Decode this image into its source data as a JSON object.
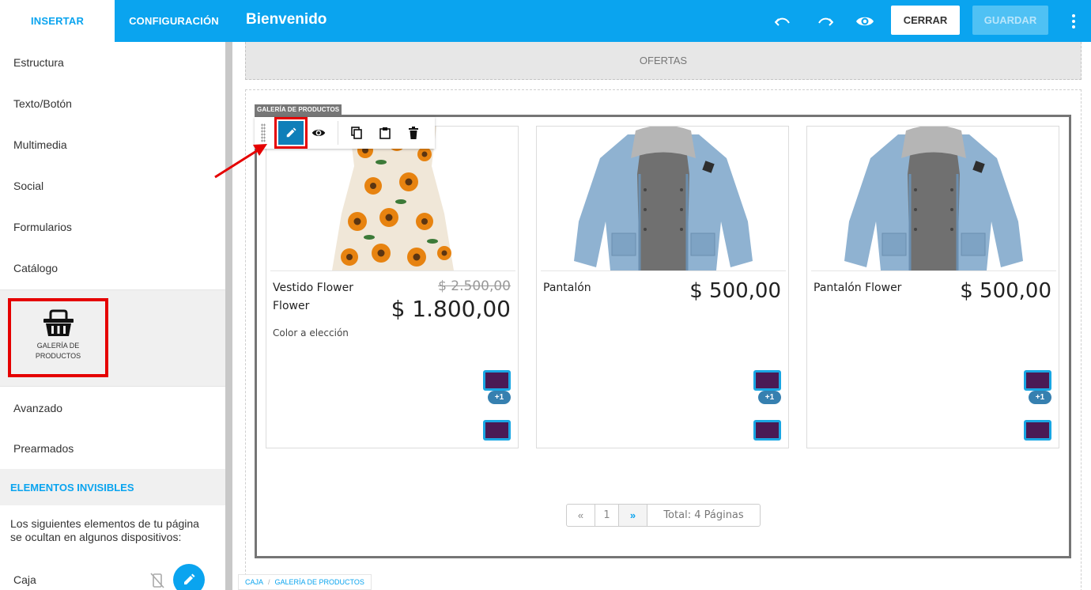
{
  "tabs": {
    "insert": "INSERTAR",
    "config": "CONFIGURACIÓN"
  },
  "header": {
    "title": "Bienvenido",
    "close_label": "CERRAR",
    "save_label": "GUARDAR"
  },
  "icons": {
    "undo": "undo-icon",
    "redo": "redo-icon",
    "preview": "eye-icon",
    "more": "kebab-menu-icon"
  },
  "colors": {
    "accent": "#0aa4ef",
    "highlight": "#e50000",
    "swatch": "#4a1a55"
  },
  "sidebar": {
    "items": [
      "Estructura",
      "Texto/Botón",
      "Multimedia",
      "Social",
      "Formularios",
      "Catálogo"
    ],
    "gallery_tile_label": "GALERÍA DE PRODUCTOS",
    "items_after": [
      "Avanzado",
      "Prearmados"
    ],
    "invisible_heading": "ELEMENTOS INVISIBLES",
    "invisible_desc": "Los siguientes elementos de tu página se ocultan en algunos dispositivos:",
    "invisible_item": "Caja"
  },
  "canvas": {
    "ofertas_label": "OFERTAS",
    "gallery_tag": "GALERÍA DE PRODUCTOS"
  },
  "products": [
    {
      "name": "Vestido Flower Flower",
      "old_price": "$ 2.500,00",
      "price": "$ 1.800,00",
      "desc": "Color a elección",
      "badge": "+1"
    },
    {
      "name": "Pantalón",
      "price": "$ 500,00",
      "badge": "+1"
    },
    {
      "name": "Pantalón Flower",
      "price": "$ 500,00",
      "badge": "+1"
    }
  ],
  "pagination": {
    "first": "«",
    "page": "1",
    "next": "»",
    "total": "Total: 4 Páginas"
  },
  "breadcrumb": {
    "item1": "CAJA",
    "separator": "/",
    "item2": "GALERÍA DE PRODUCTOS"
  }
}
